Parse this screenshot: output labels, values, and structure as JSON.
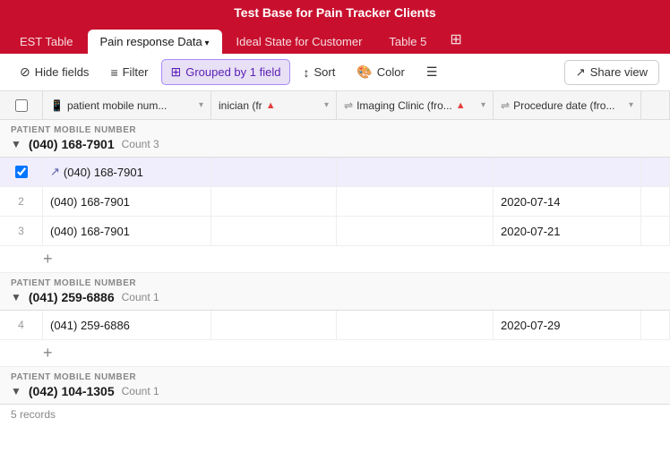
{
  "title_bar": {
    "text": "Test Base for Pain Tracker Clients"
  },
  "tabs": [
    {
      "id": "est-table",
      "label": "EST Table",
      "active": false,
      "has_arrow": false
    },
    {
      "id": "pain-response",
      "label": "Pain response Data",
      "active": true,
      "has_arrow": true
    },
    {
      "id": "ideal-state",
      "label": "Ideal State for Customer",
      "active": false,
      "has_arrow": false
    },
    {
      "id": "table-5",
      "label": "Table 5",
      "active": false,
      "has_arrow": false
    }
  ],
  "toolbar": {
    "hide_fields": "Hide fields",
    "filter": "Filter",
    "grouped_by": "Grouped by 1 field",
    "sort": "Sort",
    "color": "Color",
    "row_height": "",
    "share_view": "Share view"
  },
  "columns": [
    {
      "id": "patient",
      "label": "patient mobile num...",
      "icon": "phone",
      "warning": false
    },
    {
      "id": "clinician",
      "label": "inician (fr",
      "icon": "",
      "warning": true
    },
    {
      "id": "imaging",
      "label": "Imaging Clinic (fro...",
      "icon": "link",
      "warning": true
    },
    {
      "id": "procedure",
      "label": "Procedure date (fro...",
      "icon": "link",
      "warning": false
    }
  ],
  "groups": [
    {
      "id": "group1",
      "label": "PATIENT MOBILE NUMBER",
      "title": "(040) 168-7901",
      "count": "Count 3",
      "collapsed": false,
      "rows": [
        {
          "num": "",
          "selected": true,
          "has_expand": true,
          "patient": "(040) 168-7901",
          "clinician": "",
          "imaging": "",
          "procedure": ""
        },
        {
          "num": "2",
          "selected": false,
          "has_expand": false,
          "patient": "(040) 168-7901",
          "clinician": "",
          "imaging": "",
          "procedure": "2020-07-14"
        },
        {
          "num": "3",
          "selected": false,
          "has_expand": false,
          "patient": "(040) 168-7901",
          "clinician": "",
          "imaging": "",
          "procedure": "2020-07-21"
        }
      ]
    },
    {
      "id": "group2",
      "label": "PATIENT MOBILE NUMBER",
      "title": "(041) 259-6886",
      "count": "Count 1",
      "collapsed": false,
      "rows": [
        {
          "num": "4",
          "selected": false,
          "has_expand": false,
          "patient": "(041) 259-6886",
          "clinician": "",
          "imaging": "",
          "procedure": "2020-07-29"
        }
      ]
    },
    {
      "id": "group3",
      "label": "PATIENT MOBILE NUMBER",
      "title": "(042) 104-1305",
      "count": "Count 1",
      "collapsed": false,
      "rows": []
    }
  ],
  "footer": {
    "text": "5 records"
  }
}
